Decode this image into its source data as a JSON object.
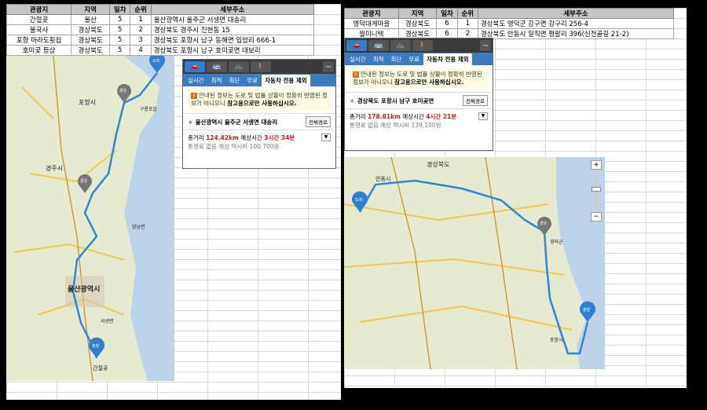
{
  "left_table": {
    "headers": [
      "관광지",
      "지역",
      "일차",
      "순위",
      "세부주소"
    ],
    "rows": [
      [
        "간절곶",
        "울산",
        "5",
        "1",
        "울산광역시 울주군 서생면 대송리"
      ],
      [
        "불국사",
        "경상북도",
        "5",
        "2",
        "경상북도 경주시 진현동 15"
      ],
      [
        "포항 마라도횟집",
        "경상북도",
        "5",
        "3",
        "경상북도 포항시 남구 동해면 입암리 666-1"
      ],
      [
        "호미곶 등상",
        "경상북도",
        "5",
        "4",
        "경상북도 포항시 남구 호미곶면 대보리"
      ]
    ]
  },
  "right_table": {
    "headers": [
      "관광지",
      "지역",
      "일차",
      "순위",
      "세부주소"
    ],
    "rows": [
      [
        "영덕대게마을",
        "경상북도",
        "6",
        "1",
        "경상북도 영덕군 강구면 강구리 256-4"
      ],
      [
        "월미니텍",
        "경상북도",
        "6",
        "2",
        "경상북도 안동시 일직면 평팔리 396(신전골길 21-2)"
      ]
    ]
  },
  "left_nav": {
    "modes": [
      "🚗",
      "🚌",
      "🚲",
      "🚶"
    ],
    "close": "−",
    "tabs": [
      "실시간",
      "최적",
      "최단",
      "무료",
      "자동차 전용 제외"
    ],
    "notice_prefix": "안내된 정보는 도로 및 법률 상황이 정확히 반영된 정보가 아니오니",
    "notice_bold": "참고용으로만 사용하십시오.",
    "destination": "울산광역시 울주군 서생면 대송리",
    "dest_button": "전체경로",
    "distance_label": "총거리",
    "distance": "124.42km",
    "time_label": "예상시간",
    "time": "3시간 34분",
    "taxi_label": "통행료 없음 예상 택시비",
    "taxi": "100,700원"
  },
  "right_nav": {
    "modes": [
      "🚗",
      "🚌",
      "🚲",
      "🚶"
    ],
    "close": "−",
    "tabs": [
      "실시간",
      "최적",
      "최단",
      "무료",
      "자동차 전용 제외"
    ],
    "notice_prefix": "안내된 정보는 도로 및 법률 상황이 정확히 반영된 정보가 아니오니",
    "notice_bold": "참고용으로만 사용하십시오.",
    "destination": "경상북도 포항시 남구 호미곶면",
    "dest_button": "전체경로",
    "distance_label": "총거리",
    "distance": "178.81km",
    "time_label": "예상시간",
    "time": "4시간 21분",
    "taxi_label": "통행료 없음 예상 택시비",
    "taxi": "139,100원"
  },
  "left_map": {
    "labels": [
      "포항시",
      "경주시",
      "울산광역시",
      "간절곶",
      "구룡포읍",
      "양남면",
      "서생면",
      "도착",
      "출발",
      "경유"
    ]
  },
  "right_map": {
    "labels": [
      "경상북도",
      "안동시",
      "영덕군",
      "포항시",
      "도착",
      "출발",
      "경유"
    ],
    "zoom_in": "+",
    "zoom_out": "−"
  },
  "colors": {
    "route": "#2f86d6",
    "tab_bar": "#3b7bc2",
    "highlight": "#d21c1c",
    "marker": "#2f7fd0",
    "waypoint": "#666666"
  }
}
